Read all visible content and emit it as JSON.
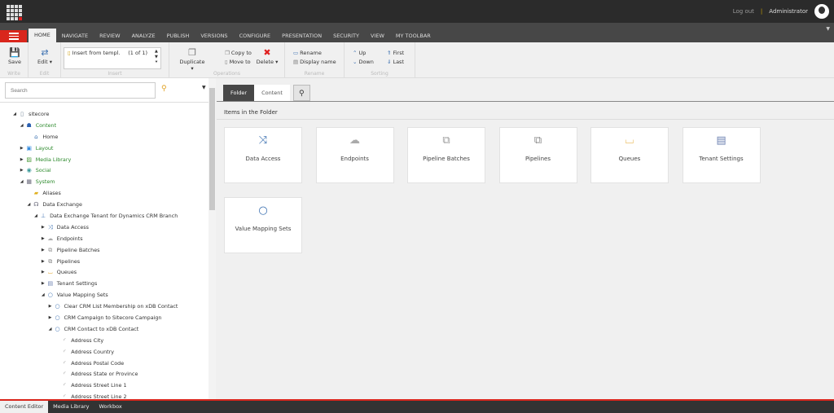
{
  "topbar": {
    "logout": "Log out",
    "separator": "|",
    "user": "Administrator"
  },
  "ribbon_tabs": [
    "HOME",
    "NAVIGATE",
    "REVIEW",
    "ANALYZE",
    "PUBLISH",
    "VERSIONS",
    "CONFIGURE",
    "PRESENTATION",
    "SECURITY",
    "VIEW",
    "MY TOOLBAR"
  ],
  "ribbon": {
    "save": "Save",
    "write": "Write",
    "edit": "Edit",
    "edit_group": "Edit",
    "insert_item": "Insert from templ.",
    "insert_count": "(1 of 1)",
    "insert_group": "Insert",
    "duplicate": "Duplicate",
    "copy_to": "Copy to",
    "move_to": "Move to",
    "delete": "Delete",
    "operations_group": "Operations",
    "rename": "Rename",
    "display_name": "Display name",
    "rename_group": "Rename",
    "up": "Up",
    "down": "Down",
    "first": "First",
    "last": "Last",
    "sorting_group": "Sorting"
  },
  "search": {
    "placeholder": "Search"
  },
  "tree": [
    {
      "label": "sitecore",
      "level": 0,
      "state": "open",
      "icon": "document-icon",
      "green": false
    },
    {
      "label": "Content",
      "level": 1,
      "state": "open",
      "icon": "content-icon",
      "green": true
    },
    {
      "label": "Home",
      "level": 2,
      "state": "none",
      "icon": "home-icon",
      "green": false
    },
    {
      "label": "Layout",
      "level": 1,
      "state": "closed",
      "icon": "layout-icon",
      "green": true
    },
    {
      "label": "Media Library",
      "level": 1,
      "state": "closed",
      "icon": "media-icon",
      "green": true
    },
    {
      "label": "Social",
      "level": 1,
      "state": "closed",
      "icon": "social-icon",
      "green": true
    },
    {
      "label": "System",
      "level": 1,
      "state": "open",
      "icon": "system-icon",
      "green": true
    },
    {
      "label": "Aliases",
      "level": 2,
      "state": "none",
      "icon": "folder-icon",
      "green": false
    },
    {
      "label": "Data Exchange",
      "level": 2,
      "state": "open",
      "icon": "headset-icon",
      "green": false
    },
    {
      "label": "Data Exchange Tenant for Dynamics CRM Branch",
      "level": 3,
      "state": "open",
      "icon": "tenant-icon",
      "green": false
    },
    {
      "label": "Data Access",
      "level": 4,
      "state": "closed",
      "icon": "shuffle-icon",
      "green": false
    },
    {
      "label": "Endpoints",
      "level": 4,
      "state": "closed",
      "icon": "cloud-icon",
      "green": false
    },
    {
      "label": "Pipeline Batches",
      "level": 4,
      "state": "closed",
      "icon": "batch-icon",
      "green": false
    },
    {
      "label": "Pipelines",
      "level": 4,
      "state": "closed",
      "icon": "pipeline-icon",
      "green": false
    },
    {
      "label": "Queues",
      "level": 4,
      "state": "closed",
      "icon": "queue-icon",
      "green": false
    },
    {
      "label": "Tenant Settings",
      "level": 4,
      "state": "closed",
      "icon": "settings-icon",
      "green": false
    },
    {
      "label": "Value Mapping Sets",
      "level": 4,
      "state": "open",
      "icon": "circle-icon",
      "green": false
    },
    {
      "label": "Clear CRM List Membership on xDB Contact",
      "level": 5,
      "state": "closed",
      "icon": "circle-icon",
      "green": false
    },
    {
      "label": "CRM Campaign to Sitecore Campaign",
      "level": 5,
      "state": "closed",
      "icon": "circle-icon",
      "green": false
    },
    {
      "label": "CRM Contact to xDB Contact",
      "level": 5,
      "state": "open",
      "icon": "circle-icon",
      "green": false
    },
    {
      "label": "Address City",
      "level": 6,
      "state": "none",
      "icon": "arc-icon",
      "green": false
    },
    {
      "label": "Address Country",
      "level": 6,
      "state": "none",
      "icon": "arc-icon",
      "green": false
    },
    {
      "label": "Address Postal Code",
      "level": 6,
      "state": "none",
      "icon": "arc-icon",
      "green": false
    },
    {
      "label": "Address State or Province",
      "level": 6,
      "state": "none",
      "icon": "arc-icon",
      "green": false
    },
    {
      "label": "Address Street Line 1",
      "level": 6,
      "state": "none",
      "icon": "arc-icon",
      "green": false
    },
    {
      "label": "Address Street Line 2",
      "level": 6,
      "state": "none",
      "icon": "arc-icon",
      "green": false
    }
  ],
  "content_tabs": {
    "folder": "Folder",
    "content": "Content"
  },
  "heading": "Items in the Folder",
  "tiles": [
    {
      "label": "Data Access",
      "icon": "shuffle-icon"
    },
    {
      "label": "Endpoints",
      "icon": "cloud-icon"
    },
    {
      "label": "Pipeline Batches",
      "icon": "batch-icon"
    },
    {
      "label": "Pipelines",
      "icon": "pipeline-icon"
    },
    {
      "label": "Queues",
      "icon": "queue-icon"
    },
    {
      "label": "Tenant Settings",
      "icon": "settings-icon"
    },
    {
      "label": "Value Mapping Sets",
      "icon": "circle-icon"
    }
  ],
  "bottom_tabs": [
    "Content Editor",
    "Media Library",
    "Workbox"
  ]
}
